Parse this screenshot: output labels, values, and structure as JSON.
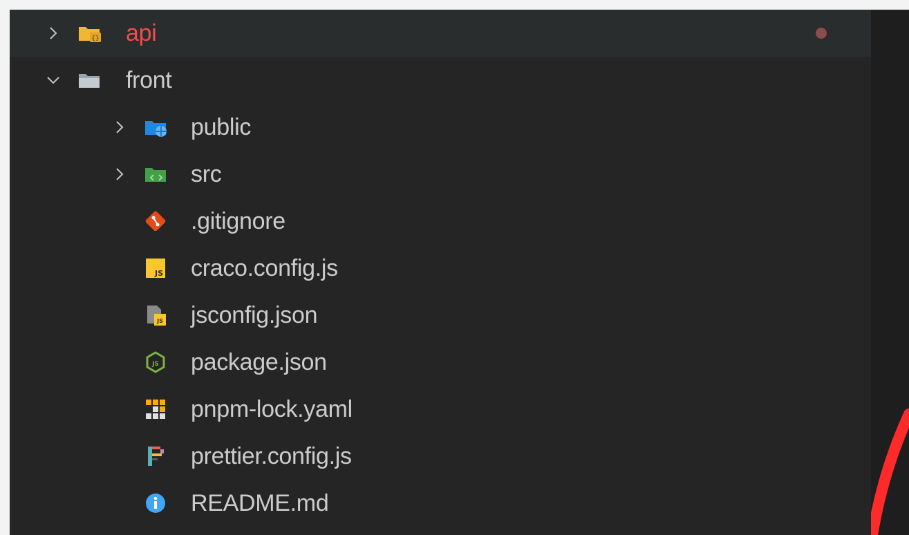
{
  "explorer": {
    "items": [
      {
        "label": "api",
        "icon": "folder-api-icon",
        "chevron": "chevron-right-icon",
        "state": "error"
      },
      {
        "label": "front",
        "icon": "folder-open-icon",
        "chevron": "chevron-down-icon"
      },
      {
        "label": "public",
        "icon": "folder-public-icon",
        "chevron": "chevron-right-icon"
      },
      {
        "label": "src",
        "icon": "folder-src-icon",
        "chevron": "chevron-right-icon"
      },
      {
        "label": ".gitignore",
        "icon": "git-icon"
      },
      {
        "label": "craco.config.js",
        "icon": "javascript-icon"
      },
      {
        "label": "jsconfig.json",
        "icon": "jsconfig-icon"
      },
      {
        "label": "package.json",
        "icon": "nodejs-icon"
      },
      {
        "label": "pnpm-lock.yaml",
        "icon": "pnpm-icon"
      },
      {
        "label": "prettier.config.js",
        "icon": "prettier-icon"
      },
      {
        "label": "README.md",
        "icon": "info-icon"
      }
    ],
    "error_dot_color": "#8e4b4b"
  }
}
